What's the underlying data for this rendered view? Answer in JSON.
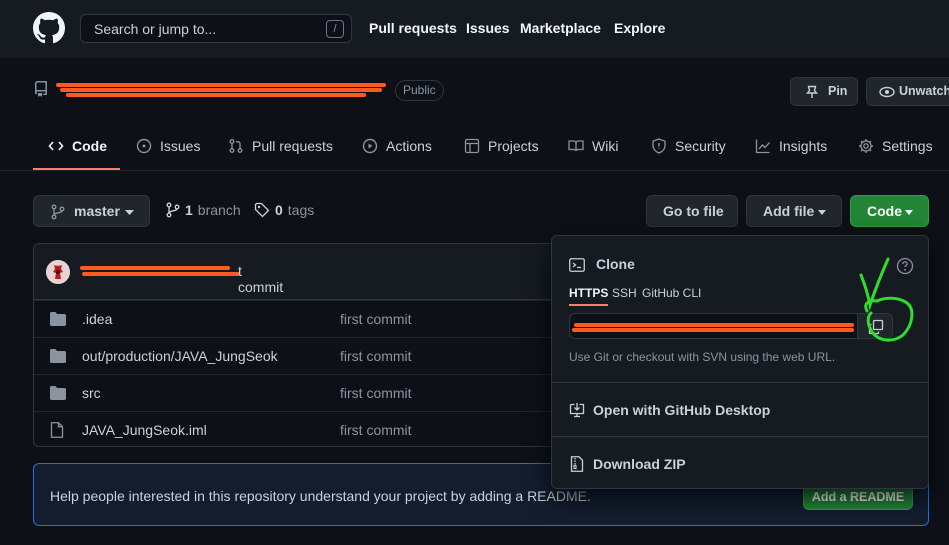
{
  "header": {
    "search_placeholder": "Search or jump to...",
    "search_key": "/",
    "nav": [
      "Pull requests",
      "Issues",
      "Marketplace",
      "Explore"
    ]
  },
  "repo": {
    "visibility": "Public",
    "pin_label": "Pin",
    "unwatch_label": "Unwatch"
  },
  "tabs": [
    {
      "label": "Code",
      "icon": "code-icon"
    },
    {
      "label": "Issues",
      "icon": "issue-icon"
    },
    {
      "label": "Pull requests",
      "icon": "pull-request-icon"
    },
    {
      "label": "Actions",
      "icon": "play-icon"
    },
    {
      "label": "Projects",
      "icon": "table-icon"
    },
    {
      "label": "Wiki",
      "icon": "book-icon"
    },
    {
      "label": "Security",
      "icon": "shield-icon"
    },
    {
      "label": "Insights",
      "icon": "graph-icon"
    },
    {
      "label": "Settings",
      "icon": "gear-icon"
    }
  ],
  "branch_bar": {
    "branch": "master",
    "branch_count": "1",
    "branch_word": "branch",
    "tag_count": "0",
    "tag_word": "tags",
    "goto_file": "Go to file",
    "add_file": "Add file",
    "code": "Code"
  },
  "latest_commit": {
    "message_tail": "t commit"
  },
  "files": [
    {
      "name": ".idea",
      "type": "folder",
      "commit": "first commit"
    },
    {
      "name": "out/production/JAVA_JungSeok",
      "type": "folder",
      "commit": "first commit"
    },
    {
      "name": "src",
      "type": "folder",
      "commit": "first commit"
    },
    {
      "name": "JAVA_JungSeok.iml",
      "type": "file",
      "commit": "first commit"
    }
  ],
  "readme_banner": {
    "text": "Help people interested in this repository understand your project by adding a README.",
    "button": "Add a README"
  },
  "clone_menu": {
    "title": "Clone",
    "protocols": [
      "HTTPS",
      "SSH",
      "GitHub CLI"
    ],
    "active_protocol": "HTTPS",
    "hint": "Use Git or checkout with SVN using the web URL.",
    "desktop": "Open with GitHub Desktop",
    "zip": "Download ZIP"
  },
  "colors": {
    "accent_green": "#238636",
    "tab_underline": "#f78166",
    "redaction": "#ff5a1f",
    "annotation": "#2dde2d"
  }
}
